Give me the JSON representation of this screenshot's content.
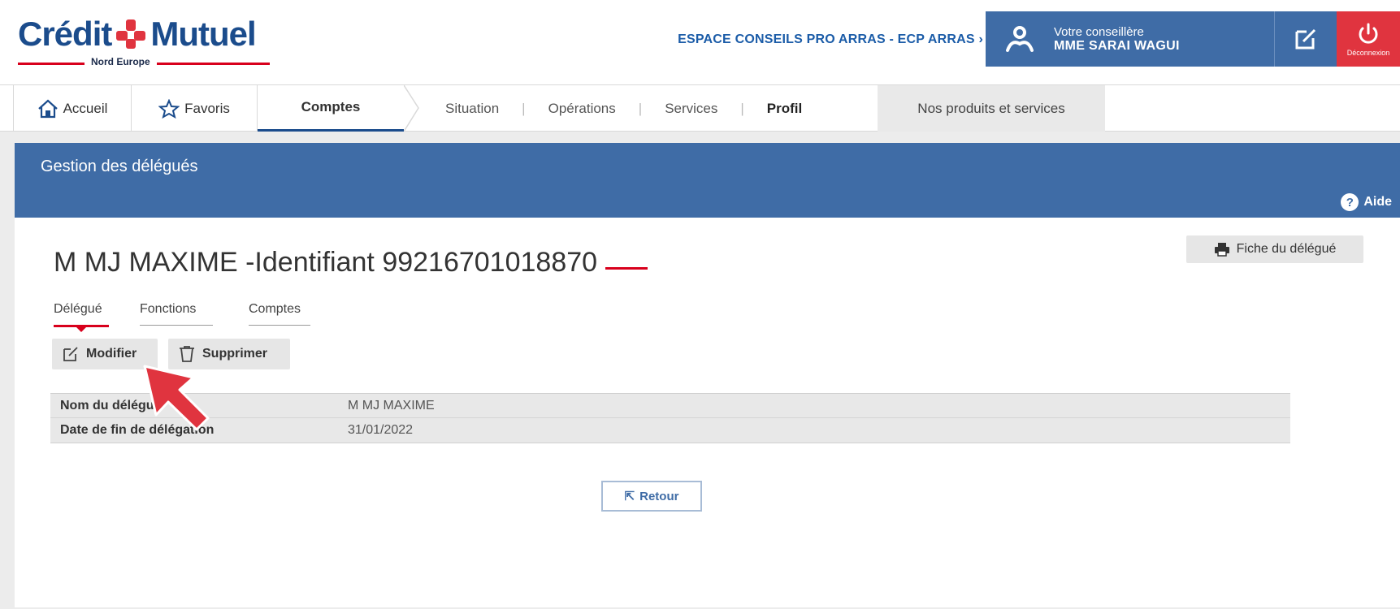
{
  "header": {
    "logo_text_left": "Crédit",
    "logo_text_right": "Mutuel",
    "logo_sub": "Nord Europe",
    "agency_link": "ESPACE CONSEILS PRO ARRAS - ECP ARRAS",
    "agency_chevron": "›",
    "advisor_label": "Votre conseillère",
    "advisor_name": "MME SARAI WAGUI",
    "logout_label": "Déconnexion"
  },
  "nav": {
    "home": "Accueil",
    "favorites": "Favoris",
    "accounts": "Comptes",
    "sub": [
      "Situation",
      "Opérations",
      "Services",
      "Profil"
    ],
    "active_sub": "Profil",
    "products": "Nos produits et services"
  },
  "page": {
    "band_title": "Gestion des délégués",
    "help_label": "Aide",
    "delegate_title": "M MJ MAXIME -Identifiant 99216701018870",
    "sheet_button": "Fiche du délégué",
    "tabs": [
      "Délégué",
      "Fonctions",
      "Comptes"
    ],
    "modify_button": "Modifier",
    "delete_button": "Supprimer",
    "details": [
      {
        "label": "Nom du délégué",
        "value": "M MJ MAXIME"
      },
      {
        "label": "Date de fin de délégation",
        "value": "31/01/2022"
      }
    ],
    "back_button": "Retour",
    "back_icon": "⇱"
  },
  "colors": {
    "brand_blue": "#3f6ca6",
    "brand_red": "#d8001c",
    "logout_red": "#e0343f"
  },
  "icons": [
    "home-icon",
    "star-icon",
    "advisor-icon",
    "edit-icon",
    "power-icon",
    "printer-icon",
    "help-icon",
    "trash-icon"
  ]
}
